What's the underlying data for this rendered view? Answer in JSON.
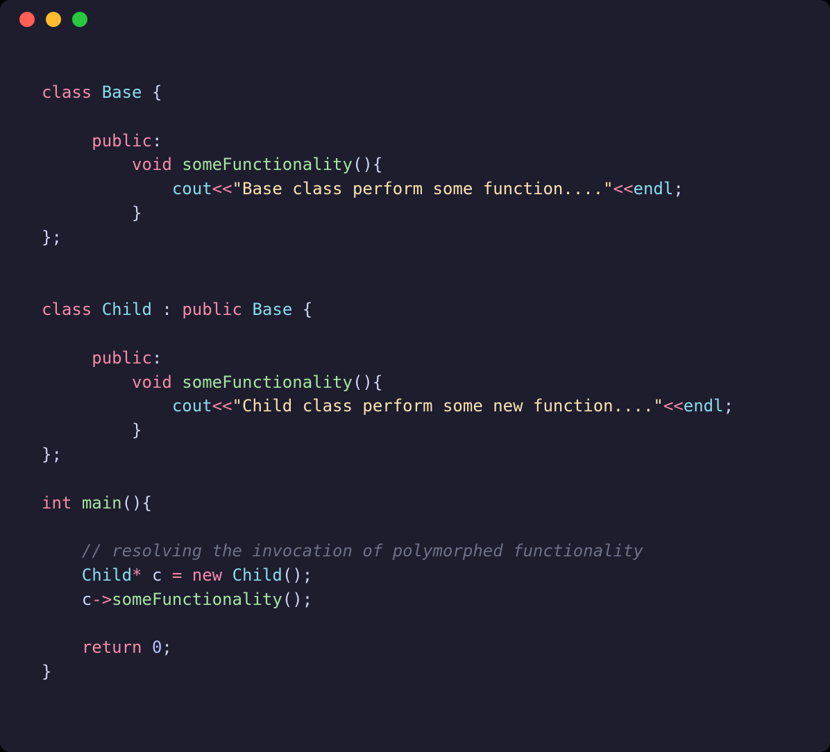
{
  "window": {
    "traffic_lights": [
      "close",
      "minimize",
      "maximize"
    ]
  },
  "code": {
    "l1": {
      "kw_class": "class",
      "type": "Base",
      "brace": " {"
    },
    "l2": "",
    "l3": {
      "indent": "     ",
      "kw": "public",
      "colon": ":"
    },
    "l4": {
      "indent": "         ",
      "kw": "void",
      "sp": " ",
      "fn": "someFunctionality",
      "paren": "(){"
    },
    "l5": {
      "indent": "             ",
      "ident1": "cout",
      "op1": "<<",
      "str": "\"Base class perform some function....\"",
      "op2": "<<",
      "ident2": "endl",
      "semi": ";"
    },
    "l6": {
      "indent": "         ",
      "brace": "}"
    },
    "l7": {
      "close": "};"
    },
    "l8": "",
    "l9": "",
    "l10": {
      "kw_class": "class",
      "type": "Child",
      "sp1": " ",
      "colon": ":",
      "sp2": " ",
      "kw_pub": "public",
      "sp3": " ",
      "base": "Base",
      "brace": " {"
    },
    "l11": "",
    "l12": {
      "indent": "     ",
      "kw": "public",
      "colon": ":"
    },
    "l13": {
      "indent": "         ",
      "kw": "void",
      "sp": " ",
      "fn": "someFunctionality",
      "paren": "(){"
    },
    "l14": {
      "indent": "             ",
      "ident1": "cout",
      "op1": "<<",
      "str": "\"Child class perform some new function....\"",
      "op2": "<<",
      "ident2": "endl",
      "semi": ";"
    },
    "l15": {
      "indent": "         ",
      "brace": "}"
    },
    "l16": {
      "close": "};"
    },
    "l17": "",
    "l18": {
      "kw": "int",
      "sp": " ",
      "fn": "main",
      "paren": "(){"
    },
    "l19": "",
    "l20": {
      "indent": "    ",
      "comment": "// resolving the invocation of polymorphed functionality"
    },
    "l21": {
      "indent": "    ",
      "type1": "Child",
      "star": "*",
      "sp1": " ",
      "var": "c",
      "sp2": " ",
      "eq": "=",
      "sp3": " ",
      "kw": "new",
      "sp4": " ",
      "type2": "Child",
      "paren": "();"
    },
    "l22": {
      "indent": "    ",
      "var": "c",
      "op": "->",
      "fn": "someFunctionality",
      "paren": "();"
    },
    "l23": "",
    "l24": {
      "indent": "    ",
      "kw": "return",
      "sp": " ",
      "num": "0",
      "semi": ";"
    },
    "l25": {
      "brace": "}"
    }
  }
}
